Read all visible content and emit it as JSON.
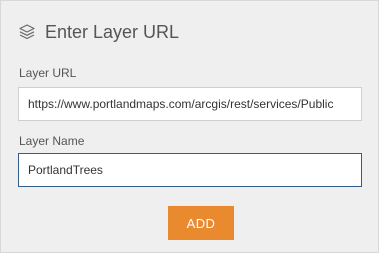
{
  "panel": {
    "title": "Enter Layer URL",
    "title_icon": "layers-icon"
  },
  "layer_url": {
    "label": "Layer URL",
    "value": "https://www.portlandmaps.com/arcgis/rest/services/Public"
  },
  "layer_name": {
    "label": "Layer Name",
    "value": "PortlandTrees"
  },
  "actions": {
    "add_label": "ADD"
  },
  "colors": {
    "panel_background": "#efefef",
    "add_button": "#ea8a2e",
    "focused_border": "#335e8a"
  }
}
